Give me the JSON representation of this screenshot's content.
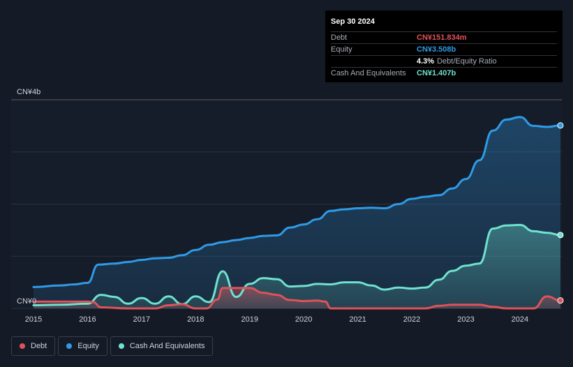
{
  "tooltip": {
    "date": "Sep 30 2024",
    "rows": [
      {
        "label": "Debt",
        "value": "CN¥151.834m",
        "color": "#e05259"
      },
      {
        "label": "Equity",
        "value": "CN¥3.508b",
        "color": "#2f9be6"
      },
      {
        "label": "",
        "value": "4.3%",
        "suffix": "Debt/Equity Ratio",
        "color": "#ffffff"
      },
      {
        "label": "Cash And Equivalents",
        "value": "CN¥1.407b",
        "color": "#6fe2cf"
      }
    ]
  },
  "legend": [
    {
      "label": "Debt",
      "color": "#e05259"
    },
    {
      "label": "Equity",
      "color": "#2f9be6"
    },
    {
      "label": "Cash And Equivalents",
      "color": "#6fe2cf"
    }
  ],
  "chart_data": {
    "type": "area",
    "x_tick_labels": [
      "2015",
      "2016",
      "2017",
      "2018",
      "2019",
      "2020",
      "2021",
      "2022",
      "2023",
      "2024"
    ],
    "y_tick_labels": [
      "CN¥0",
      "CN¥4b"
    ],
    "ylim": [
      0,
      4.0
    ],
    "xlim": [
      2015.0,
      2024.75
    ],
    "grid": true,
    "legend_position": "bottom-left",
    "series": [
      {
        "name": "Equity",
        "color": "#2f9be6",
        "x": [
          2015.0,
          2015.5,
          2015.75,
          2016.0,
          2016.2,
          2016.5,
          2016.75,
          2017.0,
          2017.25,
          2017.5,
          2017.75,
          2018.0,
          2018.25,
          2018.5,
          2018.75,
          2019.0,
          2019.25,
          2019.5,
          2019.75,
          2020.0,
          2020.25,
          2020.5,
          2020.75,
          2021.0,
          2021.25,
          2021.5,
          2021.75,
          2022.0,
          2022.25,
          2022.5,
          2022.75,
          2023.0,
          2023.25,
          2023.5,
          2023.75,
          2024.0,
          2024.25,
          2024.5,
          2024.75
        ],
        "values": [
          0.41,
          0.44,
          0.46,
          0.49,
          0.84,
          0.86,
          0.89,
          0.93,
          0.96,
          0.97,
          1.02,
          1.12,
          1.22,
          1.27,
          1.31,
          1.35,
          1.39,
          1.4,
          1.55,
          1.61,
          1.71,
          1.87,
          1.9,
          1.92,
          1.93,
          1.92,
          2.0,
          2.1,
          2.14,
          2.17,
          2.3,
          2.48,
          2.84,
          3.41,
          3.62,
          3.67,
          3.5,
          3.48,
          3.508
        ]
      },
      {
        "name": "Cash And Equivalents",
        "color": "#6fe2cf",
        "x": [
          2015.0,
          2015.5,
          2016.0,
          2016.25,
          2016.5,
          2016.75,
          2017.0,
          2017.25,
          2017.5,
          2017.75,
          2018.0,
          2018.25,
          2018.5,
          2018.75,
          2019.0,
          2019.25,
          2019.5,
          2019.75,
          2020.0,
          2020.25,
          2020.5,
          2020.75,
          2021.0,
          2021.25,
          2021.5,
          2021.75,
          2022.0,
          2022.25,
          2022.5,
          2022.75,
          2023.0,
          2023.25,
          2023.5,
          2023.75,
          2024.0,
          2024.25,
          2024.5,
          2024.75
        ],
        "values": [
          0.06,
          0.07,
          0.09,
          0.26,
          0.22,
          0.09,
          0.2,
          0.09,
          0.23,
          0.08,
          0.23,
          0.12,
          0.71,
          0.22,
          0.47,
          0.58,
          0.56,
          0.42,
          0.43,
          0.47,
          0.46,
          0.5,
          0.5,
          0.44,
          0.36,
          0.4,
          0.38,
          0.4,
          0.55,
          0.72,
          0.82,
          0.86,
          1.53,
          1.59,
          1.6,
          1.48,
          1.45,
          1.407
        ]
      },
      {
        "name": "Debt",
        "color": "#e05259",
        "x": [
          2015.0,
          2015.5,
          2016.0,
          2016.1,
          2016.25,
          2016.75,
          2017.0,
          2017.25,
          2017.5,
          2017.75,
          2018.0,
          2018.2,
          2018.4,
          2018.5,
          2018.75,
          2019.0,
          2019.25,
          2019.5,
          2019.75,
          2020.0,
          2020.25,
          2020.4,
          2020.5,
          2020.75,
          2021.0,
          2021.5,
          2022.0,
          2022.25,
          2022.5,
          2022.75,
          2023.0,
          2023.25,
          2023.5,
          2023.75,
          2024.0,
          2024.25,
          2024.5,
          2024.75
        ],
        "values": [
          0.13,
          0.13,
          0.13,
          0.12,
          0.02,
          0.0,
          0.0,
          0.0,
          0.06,
          0.08,
          0.0,
          0.0,
          0.17,
          0.39,
          0.39,
          0.39,
          0.3,
          0.26,
          0.16,
          0.14,
          0.15,
          0.13,
          0.0,
          0.0,
          0.0,
          0.0,
          0.0,
          0.0,
          0.05,
          0.07,
          0.07,
          0.07,
          0.03,
          0.0,
          0.0,
          0.0,
          0.23,
          0.151834
        ]
      }
    ]
  }
}
